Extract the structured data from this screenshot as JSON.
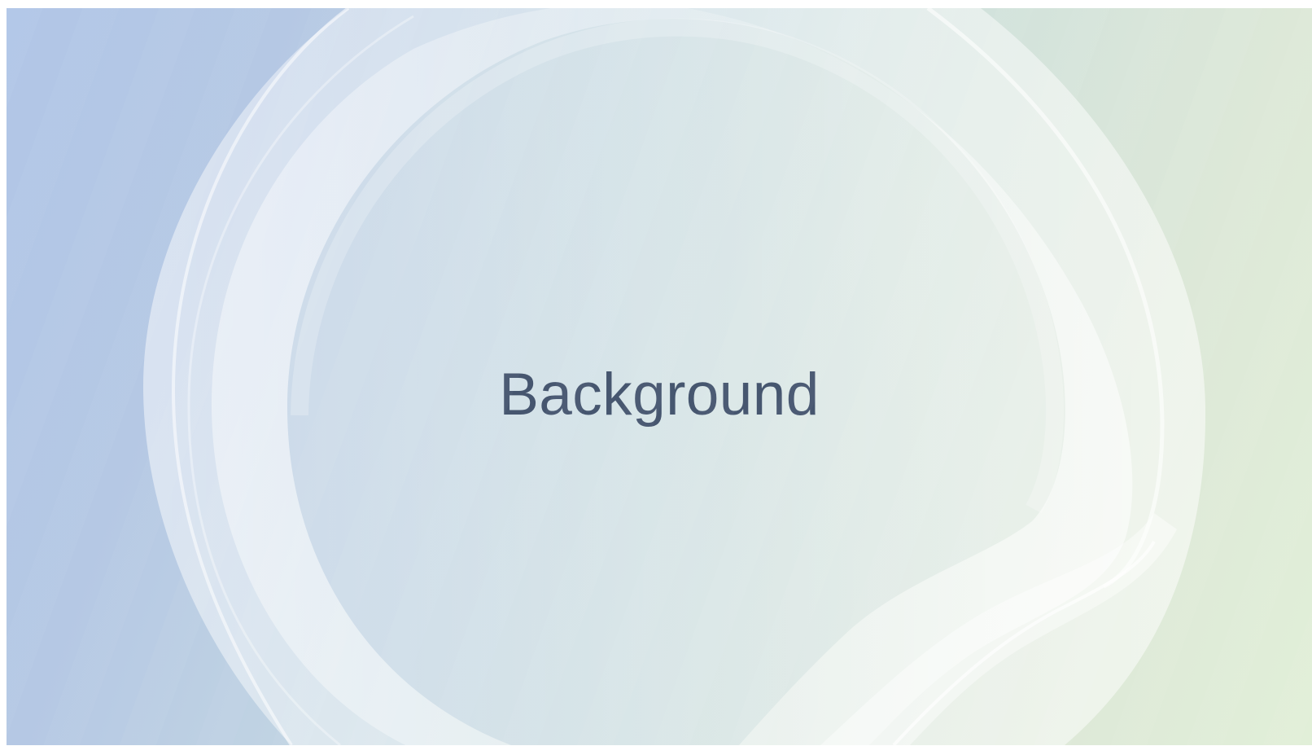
{
  "slide": {
    "title": "Background"
  },
  "colors": {
    "background_left": "#b1c6e7",
    "background_center": "#c6d9e2",
    "background_right": "#e1efd8",
    "title_text": "#46566f",
    "ring_light": "#edf1f5"
  },
  "icons": {
    "background_motif": "circle-wave-icon"
  }
}
